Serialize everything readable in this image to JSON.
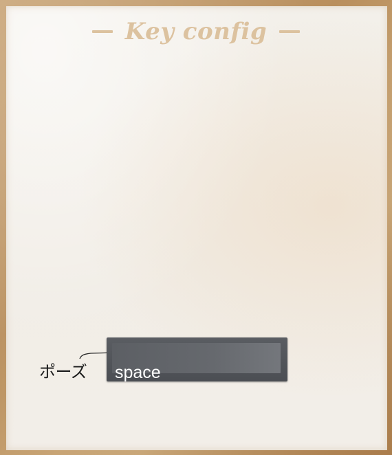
{
  "title": "Key config",
  "bindings": [
    {
      "action": "ポーズ",
      "key": "space"
    }
  ],
  "colors": {
    "title": "#dcc29f",
    "frame": "#c79a5e",
    "paper": "#f2eee8",
    "key_button": "#55585d",
    "key_text": "#ffffff",
    "label_text": "#1a1a1a"
  }
}
